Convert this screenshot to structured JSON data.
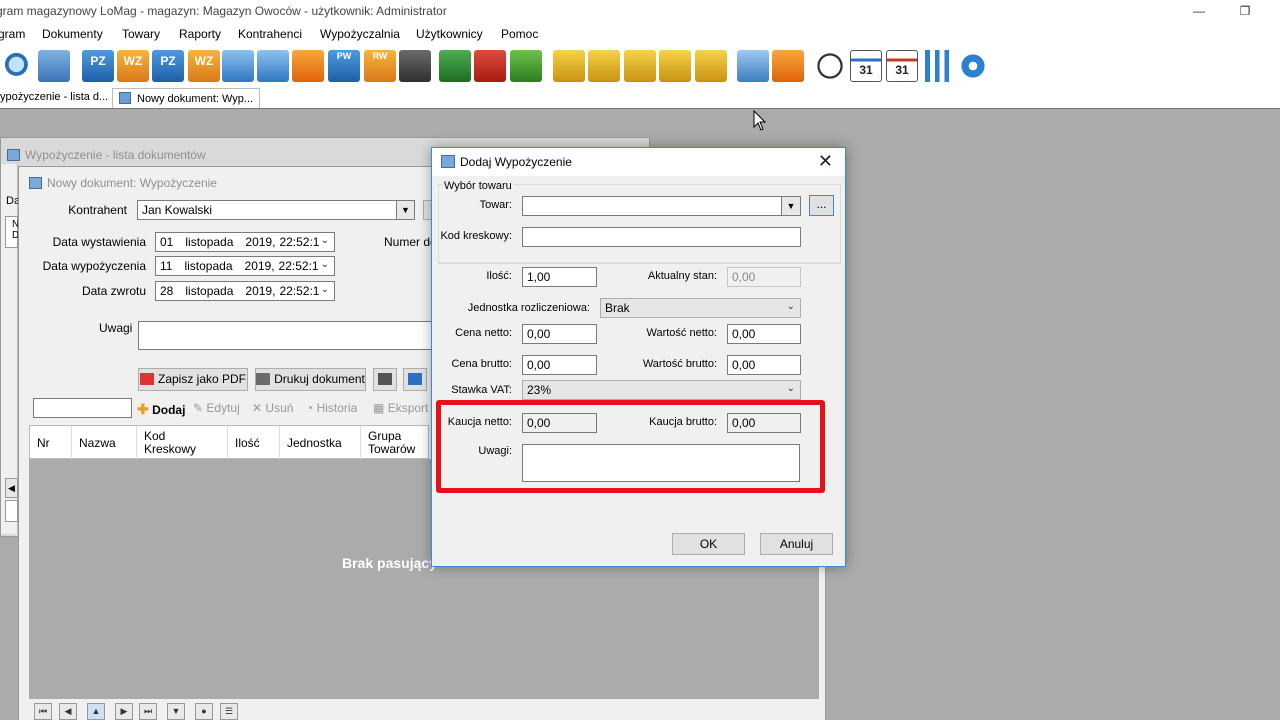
{
  "app": {
    "title": "Program magazynowy LoMag - magazyn: Magazyn Owoców - użytkownik: Administrator",
    "title_visible": "gram magazynowy LoMag - magazyn: Magazyn Owoców - użytkownik: Administrator"
  },
  "menu": [
    "gram",
    "Dokumenty",
    "Towary",
    "Raporty",
    "Kontrahenci",
    "Wypożyczalnia",
    "Użytkownicy",
    "Pomoc"
  ],
  "toolbar": {
    "labels": {
      "pz": "PZ",
      "wz": "WZ",
      "pw": "PW",
      "rw": "RW",
      "cal": "31"
    }
  },
  "tabs": [
    "ypożyczenie - lista d...",
    "Nowy dokument: Wyp..."
  ],
  "bg_window": {
    "title": "Wypożyczenie - lista dokumentów",
    "cut_label_da": "Da",
    "cut_label_n": "N",
    "cut_label_d": "D"
  },
  "doc_window": {
    "title": "Nowy dokument: Wypożyczenie",
    "kontrahent_label": "Kontrahent",
    "kontrahent_value": "Jan Kowalski",
    "numer_label": "Numer dok",
    "data_wystawienia_label": "Data wystawienia",
    "data_wypozyczenia_label": "Data wypożyczenia",
    "data_zwrotu_label": "Data zwrotu",
    "dates": [
      {
        "day": "01",
        "month": "listopada",
        "year": "2019,",
        "time": "22:52:1"
      },
      {
        "day": "11",
        "month": "listopada",
        "year": "2019,",
        "time": "22:52:1"
      },
      {
        "day": "28",
        "month": "listopada",
        "year": "2019,",
        "time": "22:52:1"
      }
    ],
    "uwagi_label": "Uwagi",
    "save_pdf": "Zapisz jako PDF",
    "print_doc": "Drukuj dokument",
    "grid_tools": {
      "add": "Dodaj",
      "edit": "Edytuj",
      "delete": "Usuń",
      "history": "Historia",
      "export": "Eksport"
    },
    "columns": {
      "nr": "Nr",
      "nazwa": "Nazwa",
      "kod1": "Kod",
      "kod2": "Kreskowy",
      "ilosc": "Ilość",
      "jednostka": "Jednostka",
      "grupa1": "Grupa",
      "grupa2": "Towarów"
    },
    "empty_text": "Brak pasujący"
  },
  "dialog": {
    "title": "Dodaj Wypożyczenie",
    "group_label": "Wybór towaru",
    "towar_label": "Towar:",
    "towar_value": "",
    "browse": "...",
    "kod_label": "Kod kreskowy:",
    "kod_value": "",
    "ilosc_label": "Ilość:",
    "ilosc_value": "1,00",
    "stan_label": "Aktualny stan:",
    "stan_value": "0,00",
    "jednostka_label": "Jednostka rozliczeniowa:",
    "jednostka_value": "Brak",
    "cena_netto_label": "Cena netto:",
    "cena_netto_value": "0,00",
    "wartosc_netto_label": "Wartość netto:",
    "wartosc_netto_value": "0,00",
    "cena_brutto_label": "Cena brutto:",
    "cena_brutto_value": "0,00",
    "wartosc_brutto_label": "Wartość brutto:",
    "wartosc_brutto_value": "0,00",
    "vat_label": "Stawka VAT:",
    "vat_value": "23%",
    "kaucja_netto_label": "Kaucja netto:",
    "kaucja_netto_value": "0,00",
    "kaucja_brutto_label": "Kaucja brutto:",
    "kaucja_brutto_value": "0,00",
    "uwagi_label": "Uwagi:",
    "uwagi_value": "",
    "ok": "OK",
    "cancel": "Anuluj"
  },
  "colors": {
    "highlight": "#e8101a",
    "dialog_border": "#3c8ad6",
    "workspace": "#ababab"
  }
}
